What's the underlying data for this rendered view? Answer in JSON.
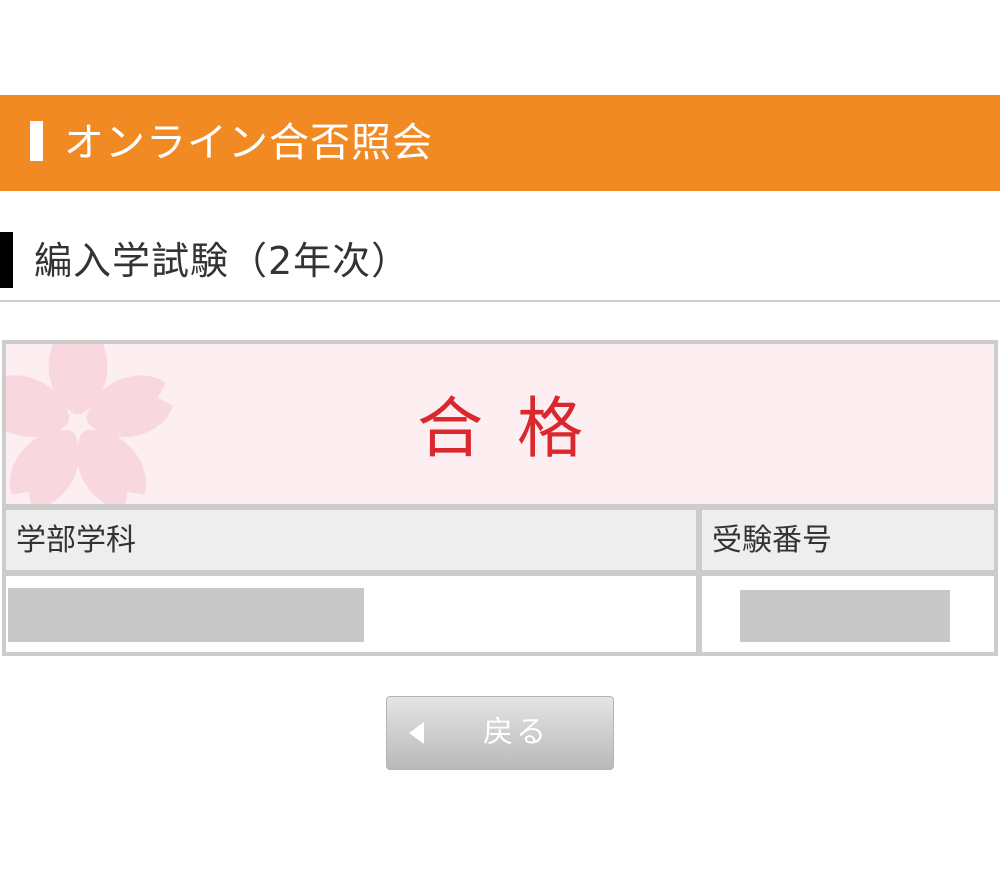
{
  "colors": {
    "brand": "#f18a23",
    "result": "#d9292f",
    "result_background": "#fdeef1",
    "redaction": "#c8c8c8"
  },
  "header": {
    "title": "オンライン合否照会"
  },
  "section": {
    "title": "編入学試験（2年次）"
  },
  "result": {
    "status": "合格",
    "decoration_icon": "sakura-icon"
  },
  "table": {
    "headers": {
      "department": "学部学科",
      "exam_number": "受験番号"
    }
  },
  "back_button": {
    "label": "戻る",
    "icon": "left-triangle-icon"
  }
}
